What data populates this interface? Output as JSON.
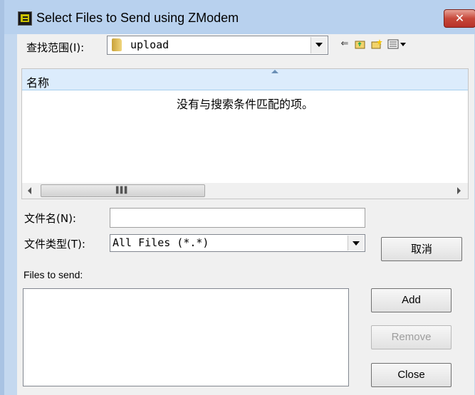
{
  "window": {
    "title": "Select Files to Send using ZModem",
    "close_label": "✕"
  },
  "lookin": {
    "label": "查找范围(I):",
    "value": "upload"
  },
  "toolbar": {
    "back_icon": "back-arrow-icon",
    "up_icon": "up-folder-icon",
    "new_folder_icon": "new-folder-icon",
    "view_icon": "view-menu-icon"
  },
  "listview": {
    "column_header": "名称",
    "empty_message": "没有与搜索条件匹配的项。"
  },
  "filename": {
    "label": "文件名(N):",
    "value": ""
  },
  "filetype": {
    "label": "文件类型(T):",
    "value": "All Files (*.*)"
  },
  "buttons": {
    "cancel": "取消",
    "add": "Add",
    "remove": "Remove",
    "close": "Close"
  },
  "files_to_send": {
    "label": "Files to send:"
  }
}
